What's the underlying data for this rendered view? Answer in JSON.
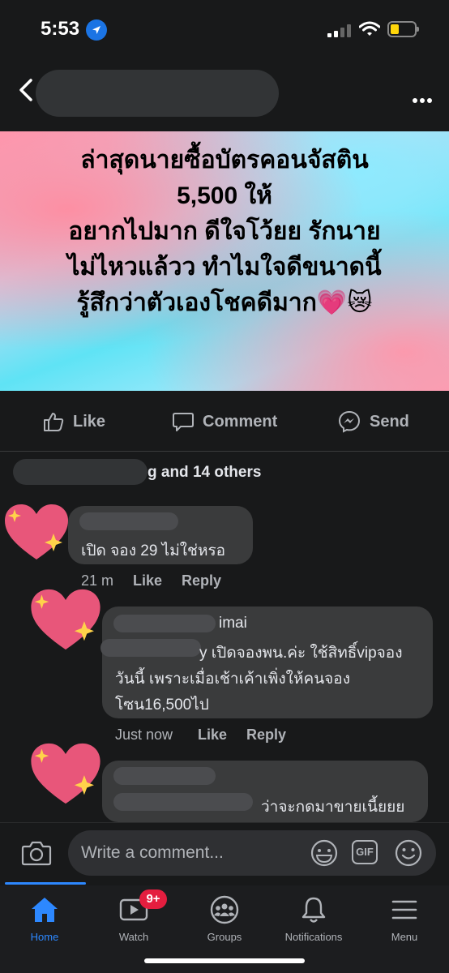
{
  "status_bar": {
    "time": "5:53"
  },
  "post": {
    "text_lines": [
      "ล่าสุดนายซื้อบัตรคอนจัสติน",
      "5,500 ให้",
      "อยากไปมาก ดีใจโว้ยย รักนาย",
      "ไม่ไหวแล้วว ทำไมใจดีขนาดนี้",
      "รู้สึกว่าตัวเองโชคดีมาก💗😿"
    ]
  },
  "actions": {
    "like": "Like",
    "comment": "Comment",
    "send": "Send"
  },
  "reactions": {
    "summary": "g and 14 others"
  },
  "comments": [
    {
      "text": "เปิด จอง 29 ไม่ใช่หรอ",
      "time": "21 m",
      "like": "Like",
      "reply": "Reply"
    },
    {
      "author_suffix": "imai",
      "line1": "y เปิดจองพน.ค่ะ ใช้สิทธิ์vipจอง",
      "line2": "วันนี้ เพราะเมื่อเช้าเค้าเพิ่งให้คนจอง",
      "line3": "โซน16,500ไป",
      "time": "Just now",
      "like": "Like",
      "reply": "Reply"
    },
    {
      "line1": "ว่าจะกดมาขายเนี้ยยย"
    }
  ],
  "composer": {
    "placeholder": "Write a comment...",
    "gif": "GIF"
  },
  "tabs": [
    {
      "label": "Home",
      "active": true
    },
    {
      "label": "Watch",
      "badge": "9+"
    },
    {
      "label": "Groups"
    },
    {
      "label": "Notifications"
    },
    {
      "label": "Menu"
    }
  ],
  "colors": {
    "accent": "#2d88ff",
    "badge": "#e41e3f",
    "background": "#18191a"
  }
}
